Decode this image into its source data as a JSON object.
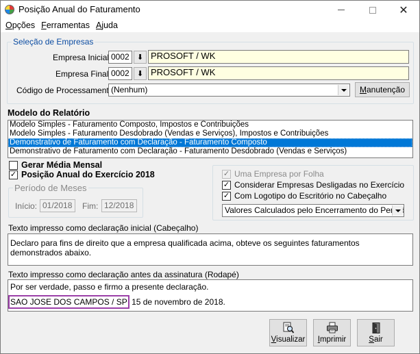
{
  "window": {
    "title": "Posição Anual do Faturamento",
    "min_icon": "minimize-icon",
    "max_icon": "maximize-icon",
    "close_symbol": "✕"
  },
  "menu": [
    {
      "key": "O",
      "rest": "pções"
    },
    {
      "key": "F",
      "rest": "erramentas"
    },
    {
      "key": "A",
      "rest": "juda"
    }
  ],
  "selecao": {
    "legend": "Seleção de Empresas",
    "empresa_inicial_label": "Empresa Inicial",
    "empresa_inicial_code": "0002",
    "empresa_inicial_name": "PROSOFT / WK",
    "empresa_final_label": "Empresa Final",
    "empresa_final_code": "0002",
    "empresa_final_name": "PROSOFT / WK",
    "codigo_label": "Código de Processamento",
    "codigo_value": "(Nenhum)",
    "manutencao_key": "M",
    "manutencao_rest": "anutenção",
    "lookup_symbol": "⬇"
  },
  "modelo": {
    "title": "Modelo do Relatório",
    "items": [
      "Modelo Simples - Faturamento Composto, Impostos e Contribuições",
      "Modelo Simples - Faturamento Desdobrado (Vendas e Serviços), Impostos e Contribuições",
      "Demonstrativo de Faturamento com Declaração - Faturamento Composto",
      "Demonstrativo de Faturamento com Declaração - Faturamento Desdobrado (Vendas e Serviços)"
    ],
    "selected_index": 2
  },
  "options": {
    "gerar_media": {
      "label": "Gerar Média Mensal",
      "checked": false
    },
    "posicao_anual": {
      "label": "Posição Anual do Exercício 2018",
      "checked": true
    }
  },
  "periodo": {
    "legend": "Período de Meses",
    "inicio_label": "Início:",
    "inicio_value": "01/2018",
    "fim_label": "Fim:",
    "fim_value": "12/2018"
  },
  "right_options": {
    "uma_empresa": {
      "label": "Uma Empresa por Folha",
      "checked": true,
      "enabled": false
    },
    "considerar": {
      "label": "Considerar Empresas Desligadas no Exercício",
      "checked": true
    },
    "logotipo": {
      "label": "Com Logotipo do Escritório no Cabeçalho",
      "checked": true
    },
    "valores_select": "Valores Calculados pelo Encerramento do Período"
  },
  "cabecalho": {
    "label": "Texto impresso como declaração inicial (Cabeçalho)",
    "text": "Declaro para fins de direito que a empresa qualificada acima, obteve os seguintes faturamentos demonstrados abaixo."
  },
  "rodape": {
    "label": "Texto impresso como declaração antes da assinatura (Rodapé)",
    "line1": "Por ser verdade, passo e firmo a presente declaração.",
    "city": "SAO JOSE DOS CAMPOS / SP",
    "date": "15 de novembro de 2018."
  },
  "buttons": {
    "visualizar": {
      "key": "V",
      "rest": "isualizar",
      "icon": "magnifier-document-icon"
    },
    "imprimir": {
      "key": "I",
      "rest": "mprimir",
      "icon": "printer-icon"
    },
    "sair": {
      "key": "S",
      "rest": "air",
      "icon": "exit-door-icon"
    }
  },
  "colors": {
    "selection": "#0078d7",
    "legend_blue": "#0c4da2",
    "highlight_border": "#9b3fa8",
    "yellow_field": "#ffffe1"
  }
}
